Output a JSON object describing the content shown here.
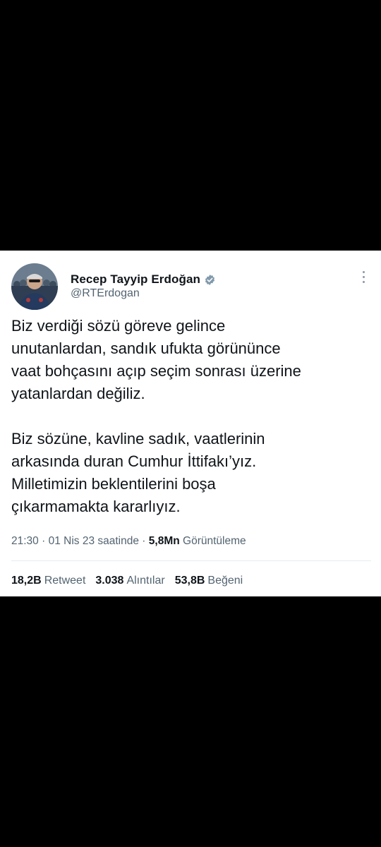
{
  "tweet": {
    "display_name": "Recep Tayyip Erdoğan",
    "verified_icon": "verified-badge-icon",
    "handle": "@RTErdogan",
    "more_icon": "more-vertical-icon",
    "paragraph1": [
      "Biz verdiği sözü göreve gelince",
      "unutanlardan, sandık ufukta görününce",
      "vaat bohçasını açıp seçim sonrası üzerine",
      "yatanlardan değiliz."
    ],
    "paragraph2": [
      "Biz sözüne, kavline sadık, vaatlerinin",
      "arkasında duran Cumhur İttifakı’yız.",
      "Milletimizin beklentilerini boşa",
      "çıkarmamakta kararlıyız."
    ],
    "meta": {
      "time": "21:30",
      "date": "01 Nis 23 saatinde",
      "separator1": "·",
      "separator2": "·",
      "views_count": "5,8Mn",
      "views_label": "Görüntüleme"
    },
    "stats": {
      "retweets_count": "18,2B",
      "retweets_label": "Retweet",
      "quotes_count": "3.038",
      "quotes_label": "Alıntılar",
      "likes_count": "53,8B",
      "likes_label": "Beğeni"
    }
  },
  "colors": {
    "background": "#000000",
    "card": "#ffffff",
    "text": "#0f1419",
    "secondary": "#536471",
    "verified": "#829aab"
  }
}
